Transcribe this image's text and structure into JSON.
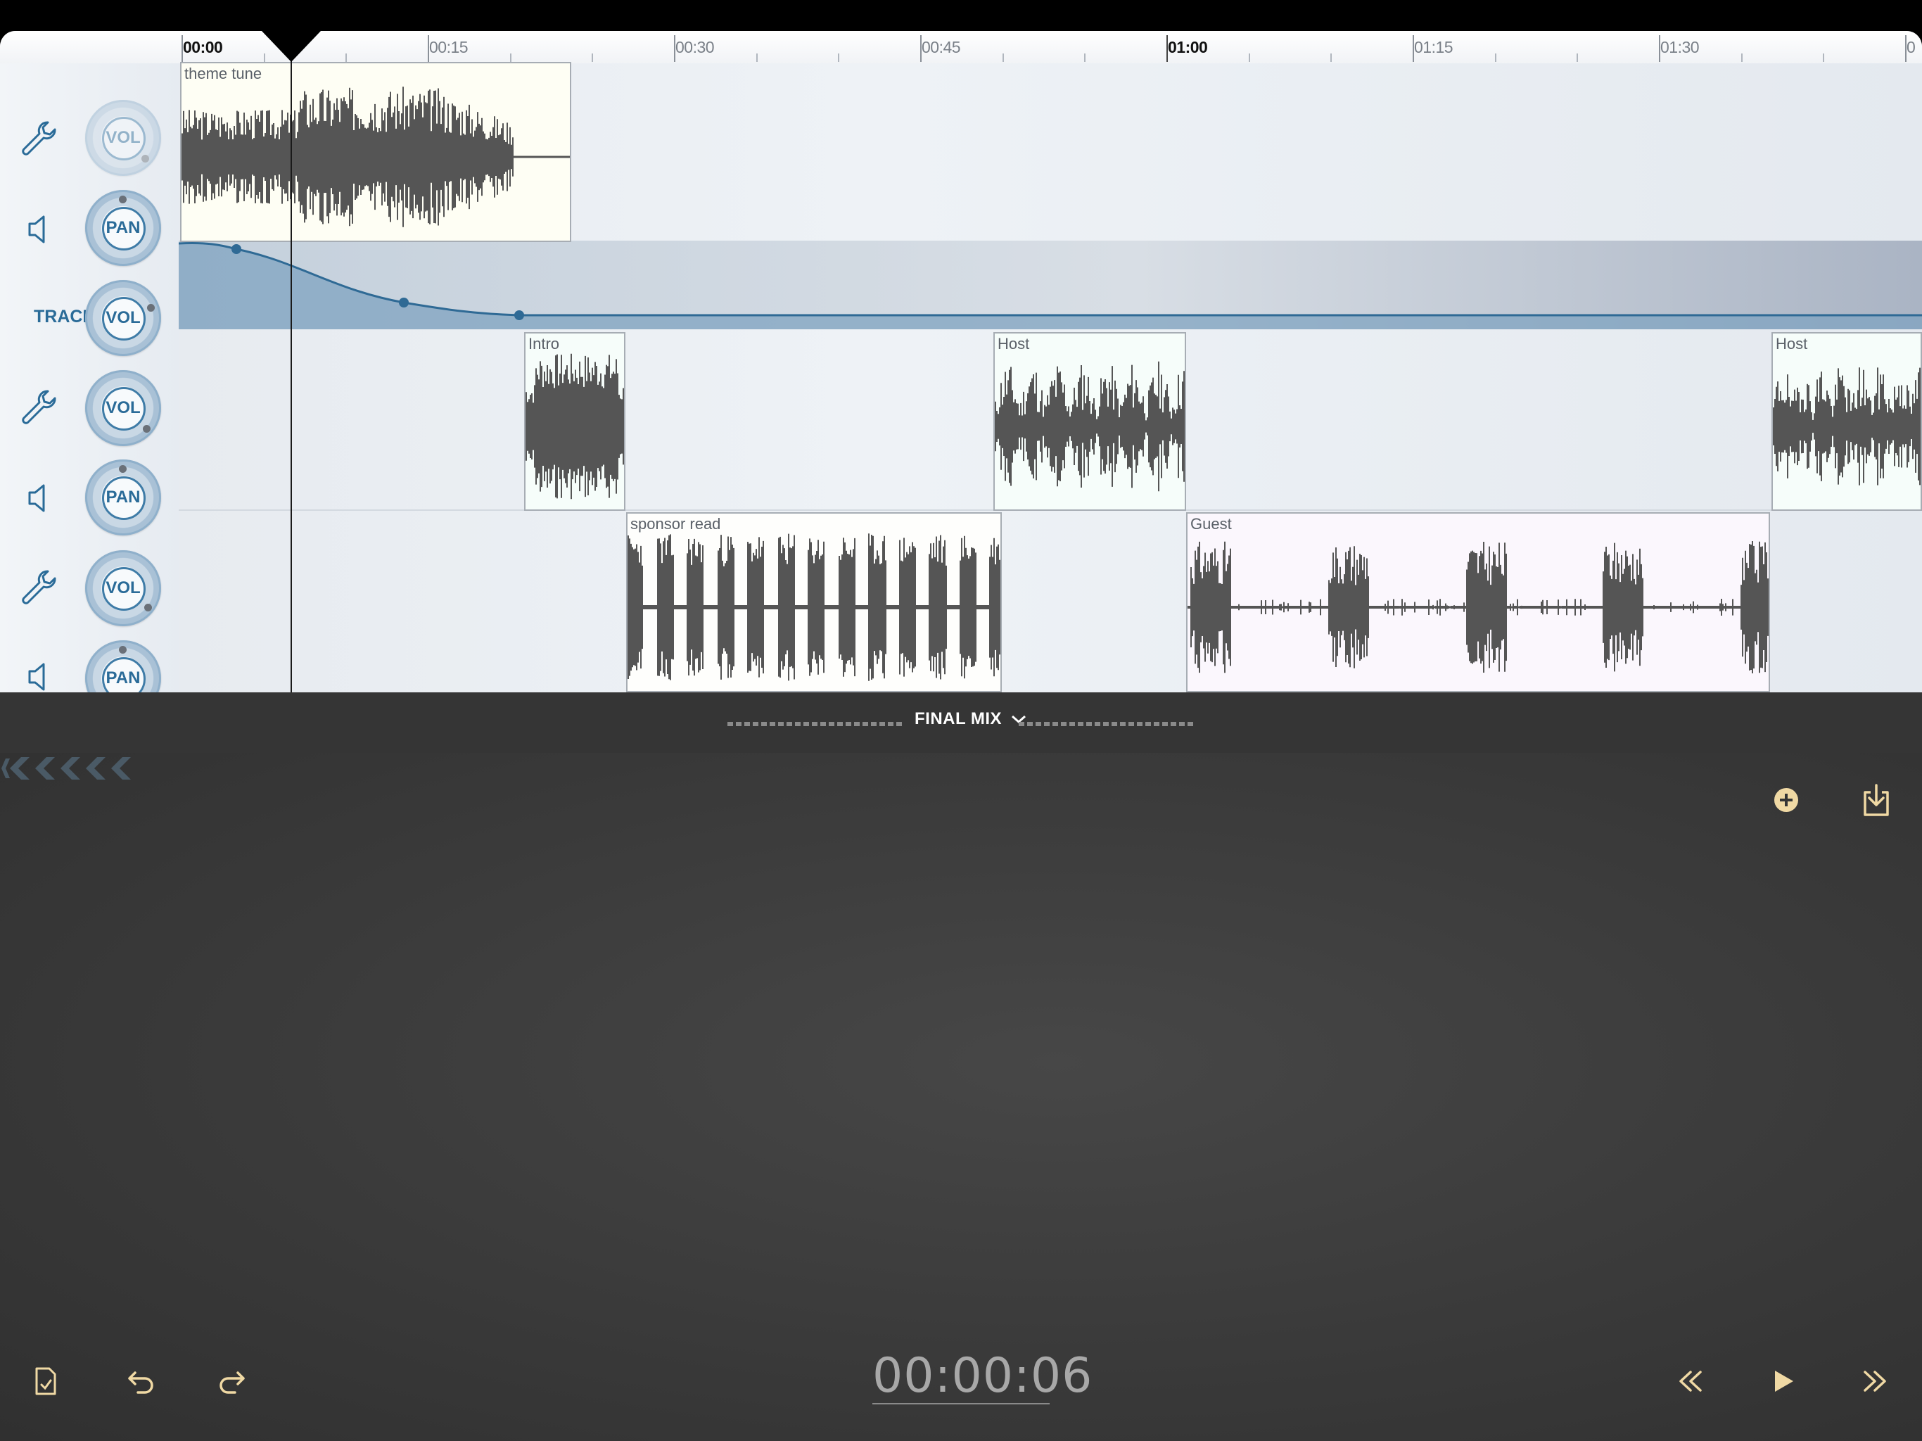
{
  "ruler": {
    "labels": [
      "00:00",
      "00:15",
      "00:30",
      "00:45",
      "01:00",
      "01:15",
      "01:30",
      "0"
    ]
  },
  "tracks": [
    {
      "name": "track-1",
      "controls": {
        "vol_label": "VOL",
        "pan_label": "PAN"
      },
      "clips": [
        {
          "label": "theme tune"
        }
      ]
    },
    {
      "name": "track-2",
      "controls": {
        "vol_label": "VOL",
        "pan_label": "PAN"
      },
      "clips": [
        {
          "label": "Intro"
        },
        {
          "label": "Host"
        },
        {
          "label": "Host"
        }
      ]
    },
    {
      "name": "track-3",
      "controls": {
        "vol_label": "VOL",
        "pan_label": "PAN"
      },
      "clips": [
        {
          "label": "sponsor read"
        },
        {
          "label": "Guest"
        }
      ]
    }
  ],
  "automation": {
    "label": "TRACK",
    "vol_label": "VOL"
  },
  "mix": {
    "title": "FINAL MIX"
  },
  "transport": {
    "timecode": "00:00:06"
  },
  "colors": {
    "accent": "#2a6b98",
    "gold": "#f0d9a4",
    "clip_music": "#fefef4",
    "clip_voice": "#f6fdfa",
    "clip_guest": "#fbf7fd"
  },
  "icons": {
    "settings": "wrench-icon",
    "speaker": "speaker-icon",
    "add": "add-icon",
    "export": "export-icon",
    "file": "file-icon",
    "undo": "undo-icon",
    "redo": "redo-icon",
    "rewind": "rewind-icon",
    "play": "play-icon",
    "forward": "fast-forward-icon"
  }
}
